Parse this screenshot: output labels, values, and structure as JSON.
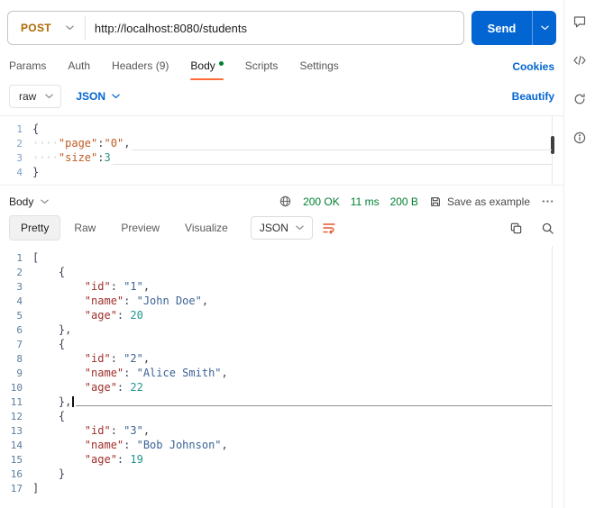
{
  "colors": {
    "accent_blue": "#0265d2",
    "method_post_orange": "#ad6800",
    "active_tab_underline": "#ff6c37",
    "status_green": "#007f31",
    "wrap_icon_orange": "#e8552f"
  },
  "request_bar": {
    "method": "POST",
    "url": "http://localhost:8080/students",
    "send_label": "Send"
  },
  "tabs": {
    "items": [
      {
        "label": "Params"
      },
      {
        "label": "Auth"
      },
      {
        "label": "Headers (9)"
      },
      {
        "label": "Body"
      },
      {
        "label": "Scripts"
      },
      {
        "label": "Settings"
      }
    ],
    "cookies_label": "Cookies"
  },
  "body_toolbar": {
    "format_mode": "raw",
    "language": "JSON",
    "beautify_label": "Beautify"
  },
  "request_editor": {
    "lines": [
      {
        "num": "1",
        "segments": [
          {
            "t": "{",
            "c": "plain"
          }
        ]
      },
      {
        "num": "2",
        "segments": [
          {
            "t": "····",
            "c": "ws"
          },
          {
            "t": "\"page\"",
            "c": "key"
          },
          {
            "t": ":",
            "c": "plain"
          },
          {
            "t": "\"0\"",
            "c": "str"
          },
          {
            "t": ",",
            "c": "plain"
          }
        ],
        "rule": "light"
      },
      {
        "num": "3",
        "segments": [
          {
            "t": "····",
            "c": "ws"
          },
          {
            "t": "\"size\"",
            "c": "key"
          },
          {
            "t": ":",
            "c": "plain"
          },
          {
            "t": "3",
            "c": "num"
          }
        ],
        "rule": "light"
      },
      {
        "num": "4",
        "segments": [
          {
            "t": "}",
            "c": "plain"
          }
        ]
      }
    ]
  },
  "response_meta": {
    "body_label": "Body",
    "status": "200 OK",
    "time": "11 ms",
    "size": "200 B",
    "save_label": "Save as example"
  },
  "response_toolbar": {
    "views": [
      {
        "label": "Pretty"
      },
      {
        "label": "Raw"
      },
      {
        "label": "Preview"
      },
      {
        "label": "Visualize"
      }
    ],
    "language": "JSON"
  },
  "response_editor": {
    "lines": [
      {
        "num": "1",
        "segments": [
          {
            "t": "[",
            "c": "plain"
          }
        ]
      },
      {
        "num": "2",
        "segments": [
          {
            "t": "    ",
            "c": "plain"
          },
          {
            "t": "{",
            "c": "plain"
          }
        ]
      },
      {
        "num": "3",
        "segments": [
          {
            "t": "        ",
            "c": "plain"
          },
          {
            "t": "\"id\"",
            "c": "key"
          },
          {
            "t": ": ",
            "c": "plain"
          },
          {
            "t": "\"1\"",
            "c": "str"
          },
          {
            "t": ",",
            "c": "plain"
          }
        ]
      },
      {
        "num": "4",
        "segments": [
          {
            "t": "        ",
            "c": "plain"
          },
          {
            "t": "\"name\"",
            "c": "key"
          },
          {
            "t": ": ",
            "c": "plain"
          },
          {
            "t": "\"John Doe\"",
            "c": "str"
          },
          {
            "t": ",",
            "c": "plain"
          }
        ]
      },
      {
        "num": "5",
        "segments": [
          {
            "t": "        ",
            "c": "plain"
          },
          {
            "t": "\"age\"",
            "c": "key"
          },
          {
            "t": ": ",
            "c": "plain"
          },
          {
            "t": "20",
            "c": "num"
          }
        ]
      },
      {
        "num": "6",
        "segments": [
          {
            "t": "    ",
            "c": "plain"
          },
          {
            "t": "},",
            "c": "plain"
          }
        ]
      },
      {
        "num": "7",
        "segments": [
          {
            "t": "    ",
            "c": "plain"
          },
          {
            "t": "{",
            "c": "plain"
          }
        ]
      },
      {
        "num": "8",
        "segments": [
          {
            "t": "        ",
            "c": "plain"
          },
          {
            "t": "\"id\"",
            "c": "key"
          },
          {
            "t": ": ",
            "c": "plain"
          },
          {
            "t": "\"2\"",
            "c": "str"
          },
          {
            "t": ",",
            "c": "plain"
          }
        ]
      },
      {
        "num": "9",
        "segments": [
          {
            "t": "        ",
            "c": "plain"
          },
          {
            "t": "\"name\"",
            "c": "key"
          },
          {
            "t": ": ",
            "c": "plain"
          },
          {
            "t": "\"Alice Smith\"",
            "c": "str"
          },
          {
            "t": ",",
            "c": "plain"
          }
        ]
      },
      {
        "num": "10",
        "segments": [
          {
            "t": "        ",
            "c": "plain"
          },
          {
            "t": "\"age\"",
            "c": "key"
          },
          {
            "t": ": ",
            "c": "plain"
          },
          {
            "t": "22",
            "c": "num"
          }
        ]
      },
      {
        "num": "11",
        "segments": [
          {
            "t": "    ",
            "c": "plain"
          },
          {
            "t": "},",
            "c": "plain"
          }
        ],
        "caret": true,
        "rule": "dark"
      },
      {
        "num": "12",
        "segments": [
          {
            "t": "    ",
            "c": "plain"
          },
          {
            "t": "{",
            "c": "plain"
          }
        ]
      },
      {
        "num": "13",
        "segments": [
          {
            "t": "        ",
            "c": "plain"
          },
          {
            "t": "\"id\"",
            "c": "key"
          },
          {
            "t": ": ",
            "c": "plain"
          },
          {
            "t": "\"3\"",
            "c": "str"
          },
          {
            "t": ",",
            "c": "plain"
          }
        ]
      },
      {
        "num": "14",
        "segments": [
          {
            "t": "        ",
            "c": "plain"
          },
          {
            "t": "\"name\"",
            "c": "key"
          },
          {
            "t": ": ",
            "c": "plain"
          },
          {
            "t": "\"Bob Johnson\"",
            "c": "str"
          },
          {
            "t": ",",
            "c": "plain"
          }
        ]
      },
      {
        "num": "15",
        "segments": [
          {
            "t": "        ",
            "c": "plain"
          },
          {
            "t": "\"age\"",
            "c": "key"
          },
          {
            "t": ": ",
            "c": "plain"
          },
          {
            "t": "19",
            "c": "num"
          }
        ]
      },
      {
        "num": "16",
        "segments": [
          {
            "t": "    ",
            "c": "plain"
          },
          {
            "t": "}",
            "c": "plain"
          }
        ]
      },
      {
        "num": "17",
        "segments": [
          {
            "t": "]",
            "c": "plain"
          }
        ]
      }
    ]
  },
  "icons": {
    "right_rail": [
      "comment-icon",
      "code-snippet-icon",
      "refresh-icon",
      "info-icon"
    ],
    "response_meta": [
      "globe-icon",
      "save-icon",
      "more-options-icon"
    ],
    "response_toolbar": [
      "wrap-text-icon",
      "copy-icon",
      "search-icon"
    ]
  }
}
